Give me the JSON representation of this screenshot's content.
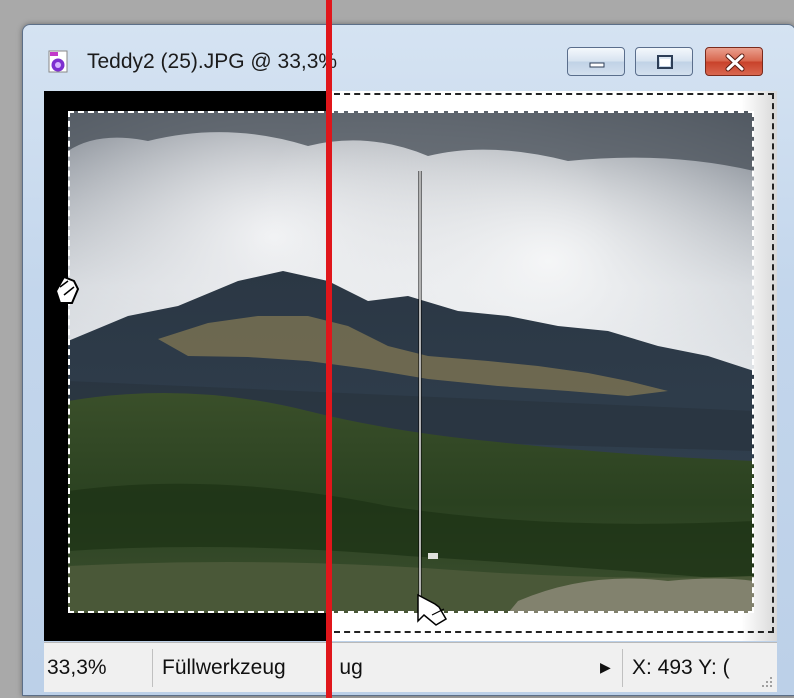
{
  "window": {
    "title": "Teddy2 (25).JPG @ 33,3%",
    "icon": "paint-shop-file-icon",
    "controls": {
      "minimize": "minimize-icon",
      "maximize": "maximize-icon",
      "close": "close-icon"
    }
  },
  "statusbar": {
    "zoom": "33,3%",
    "tool": "Füllwerkzeug",
    "tool_overlap": "ug",
    "coords": "X: 493  Y: (",
    "arrow_icon": "play-right-icon",
    "grip_icon": "resize-grip-icon"
  },
  "overlay": {
    "divider_color": "#e0161b",
    "gradient_line_icon": "gradient-drag-line-icon",
    "cursor_icon": "fill-cursor-icon",
    "side_cursor_icon": "hand-cursor-icon"
  },
  "colors": {
    "title_text": "#1b1b1b",
    "close_button": "#c8412a",
    "canvas_bg": "#000000"
  }
}
